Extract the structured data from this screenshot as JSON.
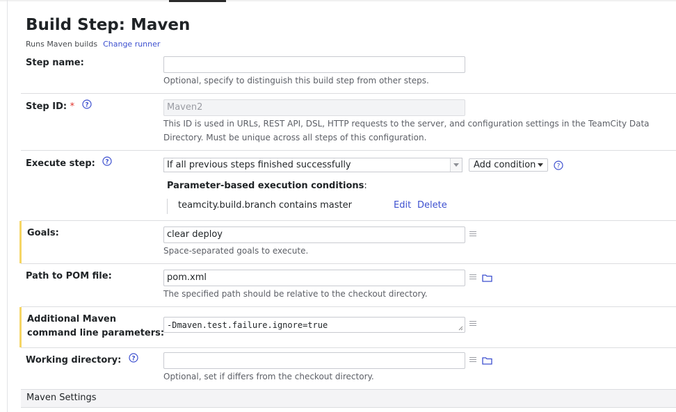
{
  "header": {
    "title": "Build Step: Maven",
    "runner_text": "Runs Maven builds",
    "change_runner": "Change runner"
  },
  "step_name": {
    "label": "Step name:",
    "value": "",
    "note": "Optional, specify to distinguish this build step from other steps."
  },
  "step_id": {
    "label": "Step ID:",
    "required_mark": "*",
    "value": "Maven2",
    "note_line1": "This ID is used in URLs, REST API, DSL, HTTP requests to the server, and configuration settings in the TeamCity Data",
    "note_line2": "Directory. Must be unique across all steps of this configuration."
  },
  "execute_step": {
    "label": "Execute step:",
    "selected": "If all previous steps finished successfully",
    "add_condition": "Add condition",
    "conditions_title": "Parameter-based execution conditions",
    "conditions_colon": ":",
    "condition": "teamcity.build.branch contains master",
    "edit": "Edit",
    "delete": "Delete"
  },
  "goals": {
    "label": "Goals:",
    "value": "clear deploy",
    "note": "Space-separated goals to execute."
  },
  "pom": {
    "label": "Path to POM file:",
    "value": "pom.xml",
    "note": "The specified path should be relative to the checkout directory."
  },
  "maven_params": {
    "label_line1": "Additional Maven",
    "label_line2": "command line parameters:",
    "value": "-Dmaven.test.failure.ignore=true"
  },
  "working_dir": {
    "label": "Working directory:",
    "value": "",
    "note": "Optional, set if differs from the checkout directory."
  },
  "section": {
    "title": "Maven Settings"
  },
  "colors": {
    "accent_link": "#3c4fcf",
    "required": "#e0322b",
    "modified_marker": "#f5d565"
  }
}
